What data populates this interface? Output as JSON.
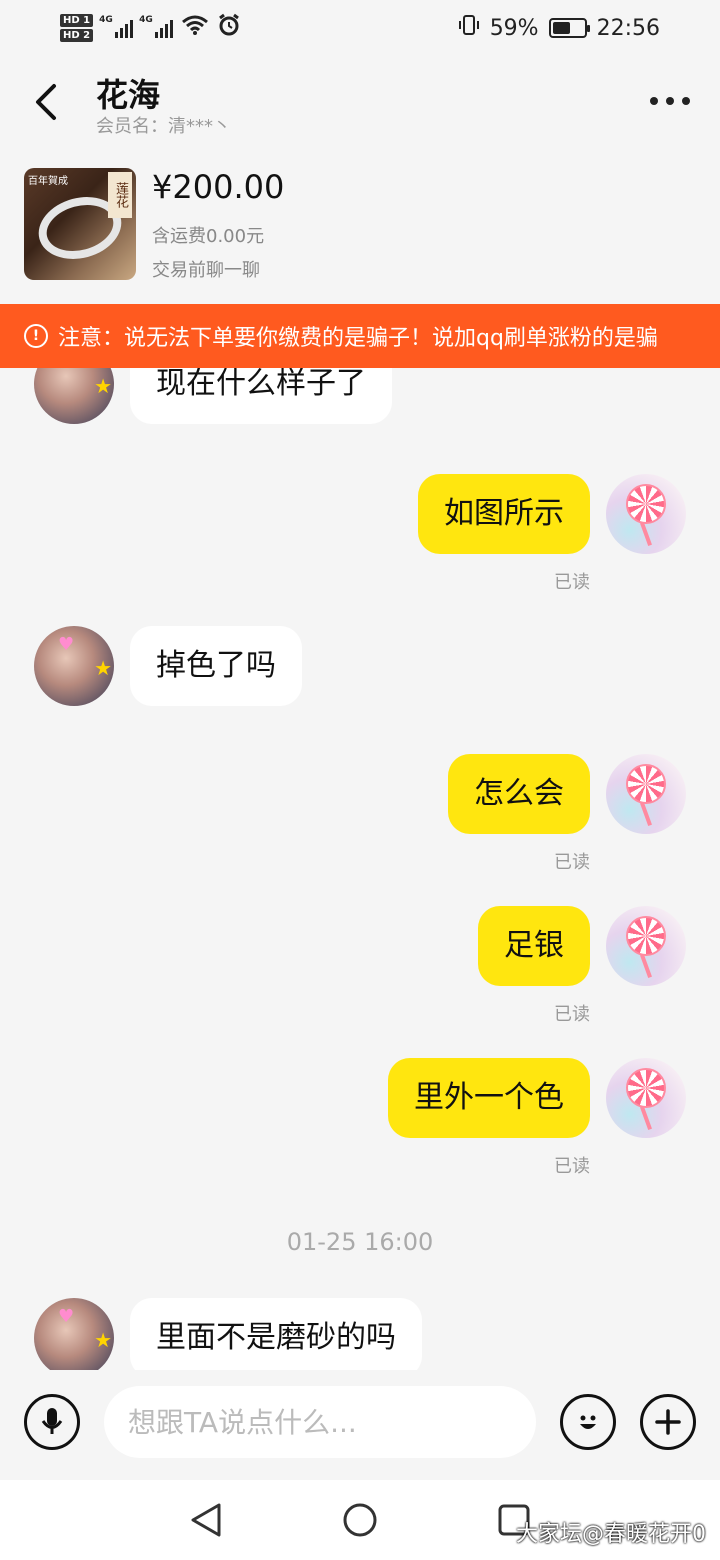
{
  "status_bar": {
    "net_tag_1": "HD 1",
    "net_tag_2": "HD 2",
    "signal_label_1": "4G",
    "signal_label_2": "4G",
    "battery_percent": "59%",
    "battery_level": 0.59,
    "time": "22:56"
  },
  "header": {
    "title": "花海",
    "subtitle": "会员名：清***丶"
  },
  "product": {
    "image_tag_text": "莲花",
    "image_brand_text": "百年賀成",
    "price": "¥200.00",
    "shipping": "含运费0.00元",
    "note": "交易前聊一聊"
  },
  "warning": {
    "text": "注意：说无法下单要你缴费的是骗子！说加qq刷单涨粉的是骗"
  },
  "messages": [
    {
      "from": "other",
      "text": "现在什么样子了"
    },
    {
      "from": "me",
      "text": "如图所示",
      "status": "已读"
    },
    {
      "from": "other",
      "text": "掉色了吗"
    },
    {
      "from": "me",
      "text": "怎么会",
      "status": "已读"
    },
    {
      "from": "me",
      "text": "足银",
      "status": "已读"
    },
    {
      "from": "me",
      "text": "里外一个色",
      "status": "已读"
    },
    {
      "from": "time",
      "text": "01-25 16:00"
    },
    {
      "from": "other",
      "text": "里面不是磨砂的吗"
    }
  ],
  "input": {
    "placeholder": "想跟TA说点什么..."
  },
  "watermark": "大家坛@春暖花开0",
  "colors": {
    "warning_bg": "#ff5a1f",
    "my_bubble": "#ffe60f",
    "other_bubble": "#ffffff",
    "background": "#f5f5f5"
  }
}
